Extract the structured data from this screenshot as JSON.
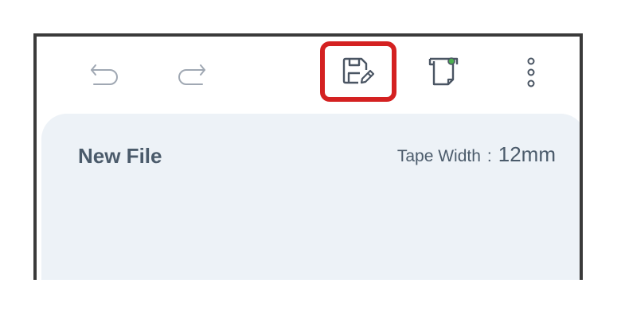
{
  "toolbar": {
    "undo_icon": "undo-icon",
    "redo_icon": "redo-icon",
    "save_icon": "save-edit-icon",
    "print_icon": "print-label-icon",
    "more_icon": "more-vertical-icon",
    "highlight_color": "#d42121"
  },
  "document": {
    "title": "New File",
    "tape_width_label": "Tape Width",
    "tape_width_separator": ":",
    "tape_width_value": "12mm"
  },
  "colors": {
    "panel_background": "#edf2f7",
    "text": "#4b5b6b",
    "icon": "#4a5563",
    "status_dot": "#4caf50"
  }
}
